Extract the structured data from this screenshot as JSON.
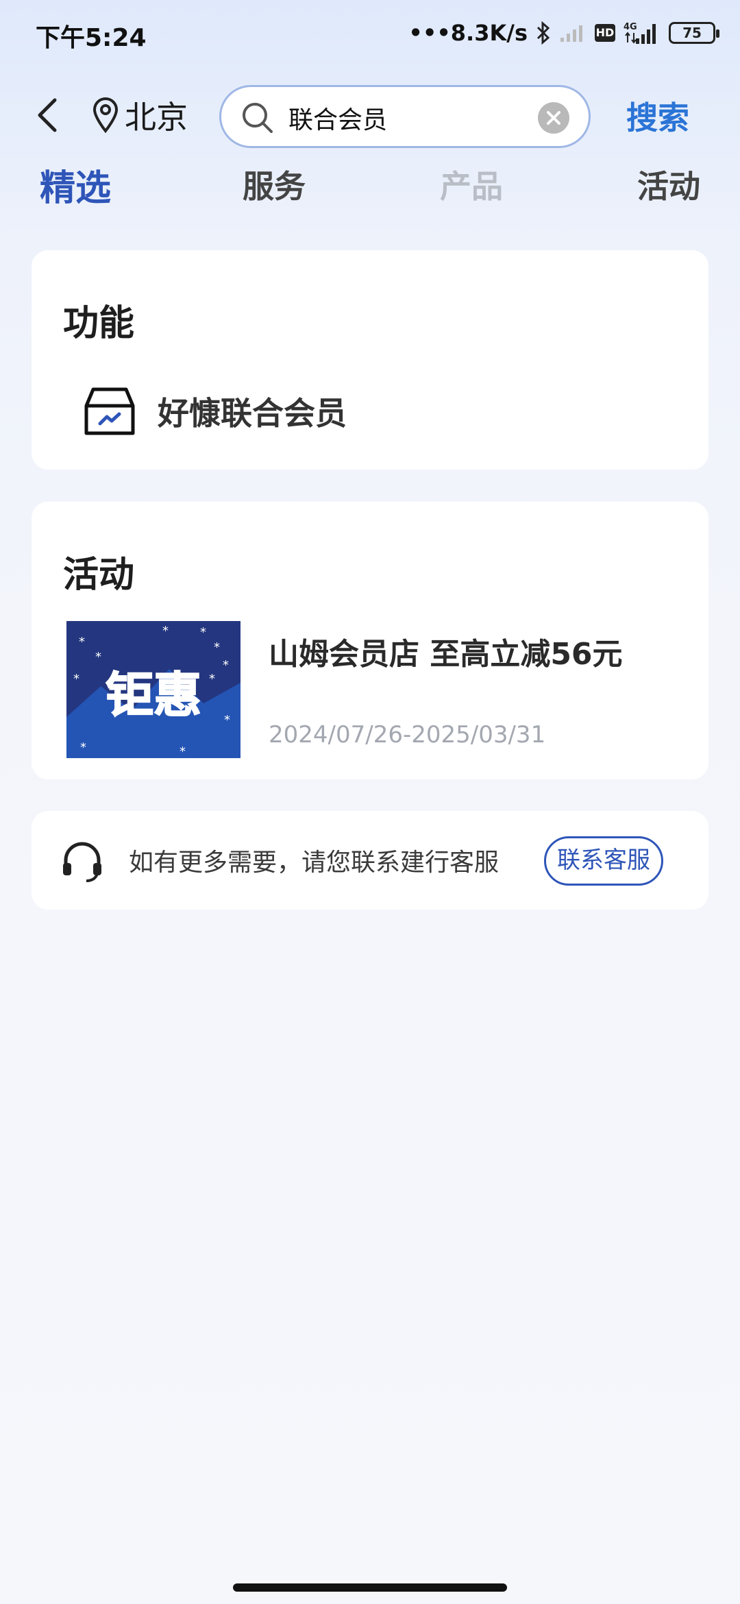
{
  "status_bar": {
    "time": "下午5:24",
    "network_speed": "8.3K/s",
    "battery": "75",
    "hd_label": "HD",
    "signal_label": "4G",
    "icons": [
      "bluetooth-icon",
      "signal-weak-icon",
      "hd-icon",
      "signal-4g-icon",
      "battery-icon"
    ]
  },
  "header": {
    "location": "北京",
    "search_query": "联合会员",
    "search_button": "搜索"
  },
  "tabs": [
    {
      "label": "精选",
      "state": "active"
    },
    {
      "label": "服务",
      "state": "normal"
    },
    {
      "label": "产品",
      "state": "disabled"
    },
    {
      "label": "活动",
      "state": "normal"
    }
  ],
  "function_section": {
    "title": "功能",
    "items": [
      {
        "label": "好慷联合会员",
        "icon": "box-chart-icon"
      }
    ]
  },
  "activity_section": {
    "title": "活动",
    "items": [
      {
        "image_text": "钜惠",
        "title": "山姆会员店 至高立减56元",
        "date_range": "2024/07/26-2025/03/31"
      }
    ]
  },
  "help": {
    "text": "如有更多需要，请您联系建行客服",
    "button": "联系客服",
    "icon": "headset-icon"
  },
  "colors": {
    "accent": "#2e55b8",
    "search_blue": "#2a74d6",
    "promo_blue": "#2454b4"
  }
}
